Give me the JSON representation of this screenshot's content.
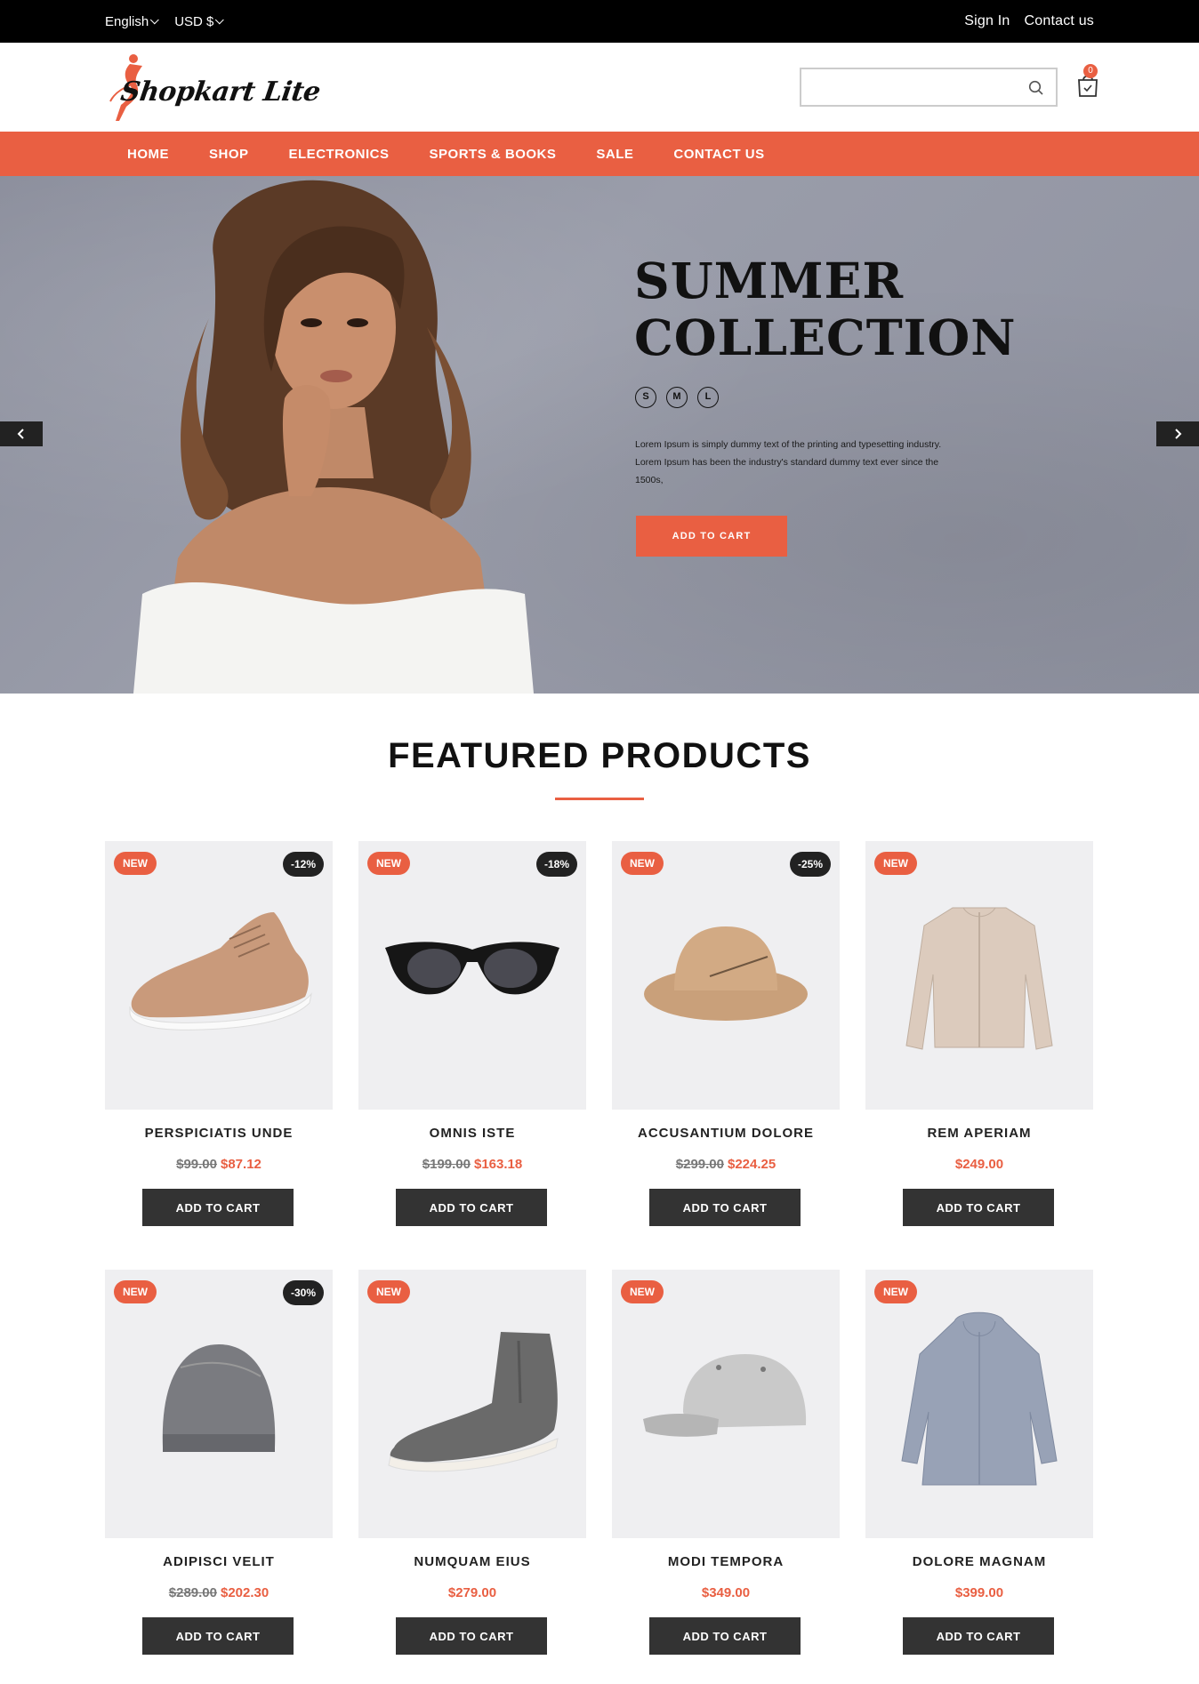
{
  "topbar": {
    "language": "English",
    "currency": "USD $",
    "sign_in": "Sign In",
    "contact": "Contact us"
  },
  "header": {
    "logo_text": "Shopkart Lite",
    "search_placeholder": "",
    "cart_count": "0"
  },
  "nav": {
    "items": [
      "HOME",
      "SHOP",
      "ELECTRONICS",
      "SPORTS & BOOKS",
      "SALE",
      "CONTACT US"
    ]
  },
  "hero": {
    "title_line1": "SUMMER",
    "title_line2": "COLLECTION",
    "sizes": [
      "S",
      "M",
      "L"
    ],
    "text": "Lorem Ipsum is simply dummy text of the printing and typesetting industry. Lorem Ipsum has been the industry's standard dummy text ever since the 1500s,",
    "button": "ADD TO CART"
  },
  "featured": {
    "title": "FEATURED PRODUCTS",
    "products": [
      {
        "name": "PERSPICIATIS UNDE",
        "old_price": "$99.00",
        "price": "$87.12",
        "badge": "NEW",
        "discount": "-12%",
        "button": "ADD TO CART",
        "icon": "sneaker-icon"
      },
      {
        "name": "OMNIS ISTE",
        "old_price": "$199.00",
        "price": "$163.18",
        "badge": "NEW",
        "discount": "-18%",
        "button": "ADD TO CART",
        "icon": "sunglasses-icon"
      },
      {
        "name": "ACCUSANTIUM DOLORE",
        "old_price": "$299.00",
        "price": "$224.25",
        "badge": "NEW",
        "discount": "-25%",
        "button": "ADD TO CART",
        "icon": "hat-icon"
      },
      {
        "name": "REM APERIAM",
        "old_price": "",
        "price": "$249.00",
        "badge": "NEW",
        "discount": "",
        "button": "ADD TO CART",
        "icon": "jacket-icon"
      },
      {
        "name": "ADIPISCI VELIT",
        "old_price": "$289.00",
        "price": "$202.30",
        "badge": "NEW",
        "discount": "-30%",
        "button": "ADD TO CART",
        "icon": "beanie-icon"
      },
      {
        "name": "NUMQUAM EIUS",
        "old_price": "",
        "price": "$279.00",
        "badge": "NEW",
        "discount": "",
        "button": "ADD TO CART",
        "icon": "boot-icon"
      },
      {
        "name": "MODI TEMPORA",
        "old_price": "",
        "price": "$349.00",
        "badge": "NEW",
        "discount": "",
        "button": "ADD TO CART",
        "icon": "cap-icon"
      },
      {
        "name": "DOLORE MAGNAM",
        "old_price": "",
        "price": "$399.00",
        "badge": "NEW",
        "discount": "",
        "button": "ADD TO CART",
        "icon": "raincoat-icon"
      }
    ]
  },
  "colors": {
    "accent": "#e95f42",
    "dark": "#333333",
    "topbar": "#000000"
  }
}
